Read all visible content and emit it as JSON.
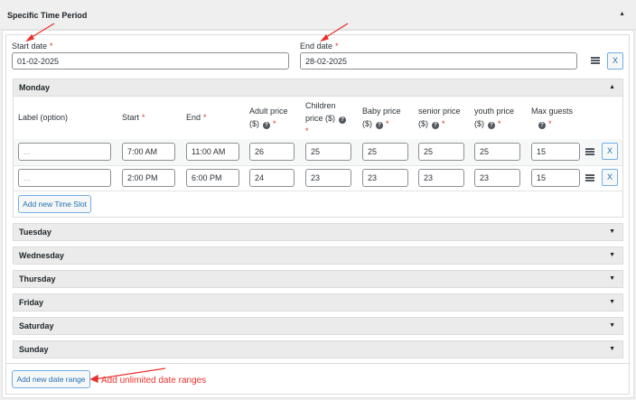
{
  "section": {
    "title": "Specific Time Period"
  },
  "range": {
    "start_label": "Start date",
    "start_value": "01-02-2025",
    "end_label": "End date",
    "end_value": "28-02-2025",
    "remove_label": "X"
  },
  "monday": {
    "title": "Monday",
    "columns": {
      "label": "Label (option)",
      "start": "Start",
      "end": "End",
      "adult": "Adult price",
      "adult2": "($)",
      "children": "Children",
      "children2": "price ($)",
      "baby": "Baby price",
      "baby2": "($)",
      "senior": "senior price",
      "senior2": "($)",
      "youth": "youth price",
      "youth2": "($)",
      "max": "Max guests"
    },
    "rows": [
      {
        "label": "",
        "placeholder": "...",
        "start": "7:00 AM",
        "end": "11:00 AM",
        "adult": "26",
        "children": "25",
        "baby": "25",
        "senior": "25",
        "youth": "25",
        "max": "15",
        "remove": "X"
      },
      {
        "label": "",
        "placeholder": "...",
        "start": "2:00 PM",
        "end": "6:00 PM",
        "adult": "24",
        "children": "23",
        "baby": "23",
        "senior": "23",
        "youth": "23",
        "max": "15",
        "remove": "X"
      }
    ],
    "add_slot": "Add new Time Slot"
  },
  "days": [
    "Tuesday",
    "Wednesday",
    "Thursday",
    "Friday",
    "Saturday",
    "Sunday"
  ],
  "add_range": "Add new date range",
  "annotation": "Add unlimited date ranges",
  "required_mark": "*",
  "help_mark": "?"
}
